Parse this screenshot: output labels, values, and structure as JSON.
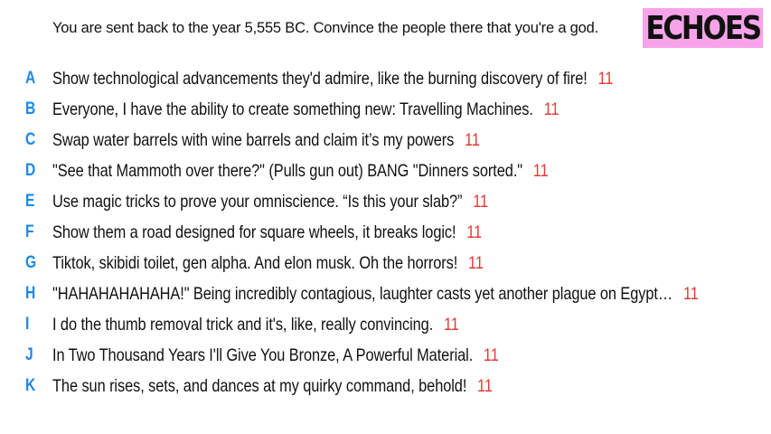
{
  "question": {
    "text": "You are sent back to the year 5,555 BC. Convince the people there that you're a god."
  },
  "logo": {
    "text": "ECHOES",
    "background": "#f7a3ea"
  },
  "colors": {
    "letter": "#1e88e5",
    "score": "#e53935"
  },
  "answers": [
    {
      "letter": "A",
      "text": "Show technological advancements they'd admire, like the burning discovery of fire!",
      "score": "11"
    },
    {
      "letter": "B",
      "text": "Everyone, I have the ability to create something new: Travelling Machines.",
      "score": "11"
    },
    {
      "letter": "C",
      "text": "Swap water barrels with wine barrels and claim it’s my powers",
      "score": "11"
    },
    {
      "letter": "D",
      "text": "\"See that Mammoth over there?\" (Pulls gun out) BANG \"Dinners sorted.\"",
      "score": "11"
    },
    {
      "letter": "E",
      "text": "Use magic tricks to prove your omniscience. “Is this your slab?”",
      "score": "11"
    },
    {
      "letter": "F",
      "text": "Show them a road designed for square wheels, it breaks logic!",
      "score": "11"
    },
    {
      "letter": "G",
      "text": "Tiktok, skibidi toilet, gen alpha. And elon musk. Oh the horrors!",
      "score": "11"
    },
    {
      "letter": "H",
      "text": "\"HAHAHAHAHAHA!\" Being incredibly contagious, laughter casts yet another plague on Egypt…",
      "score": "11"
    },
    {
      "letter": "I",
      "text": "I do the thumb removal trick and it's, like, really convincing.",
      "score": "11"
    },
    {
      "letter": "J",
      "text": "In Two Thousand Years I'll Give You Bronze, A Powerful Material.",
      "score": "11"
    },
    {
      "letter": "K",
      "text": "The sun rises, sets, and dances at my quirky command, behold!",
      "score": "11"
    }
  ]
}
